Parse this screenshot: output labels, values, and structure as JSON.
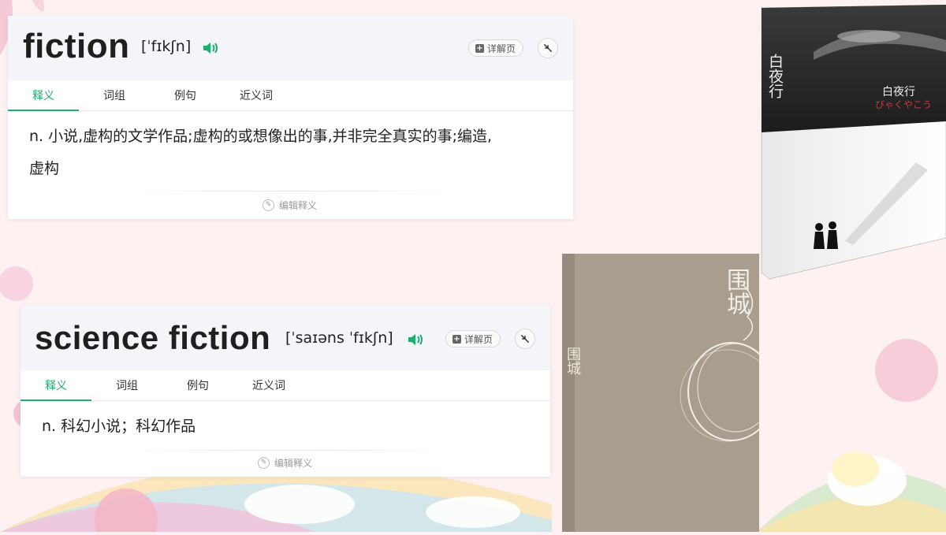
{
  "entries": [
    {
      "word": "fiction",
      "phonetic": "[ˈfɪkʃn]",
      "detail_label": "详解页",
      "tabs": [
        "释义",
        "词组",
        "例句",
        "近义词"
      ],
      "definition_line1": "n.  小说,虚构的文学作品;虚构的或想像出的事,并非完全真实的事;编造,",
      "definition_line2": "虚构",
      "edit_label": "编辑释义"
    },
    {
      "word": "science fiction",
      "phonetic": "[ˈsaɪəns ˈfɪkʃn]",
      "detail_label": "详解页",
      "tabs": [
        "释义",
        "词组",
        "例句",
        "近义词"
      ],
      "definition_line1": "n.  科幻小说；科幻作品",
      "edit_label": "编辑释义"
    }
  ],
  "books": {
    "byakuyako": {
      "spine_title": "白夜行",
      "title": "白夜行",
      "kana": "びゃくやこう"
    },
    "weicheng": {
      "cover_title": "围城",
      "spine_title": "围城"
    }
  },
  "icons": {
    "speaker": "speaker-icon",
    "detail": "document-plus-icon",
    "collapse": "collapse-arrows-icon",
    "edit": "pencil-icon"
  },
  "colors": {
    "accent_green": "#1fae72",
    "card_header": "#f4f5f9",
    "background": "#fdf1f1"
  }
}
